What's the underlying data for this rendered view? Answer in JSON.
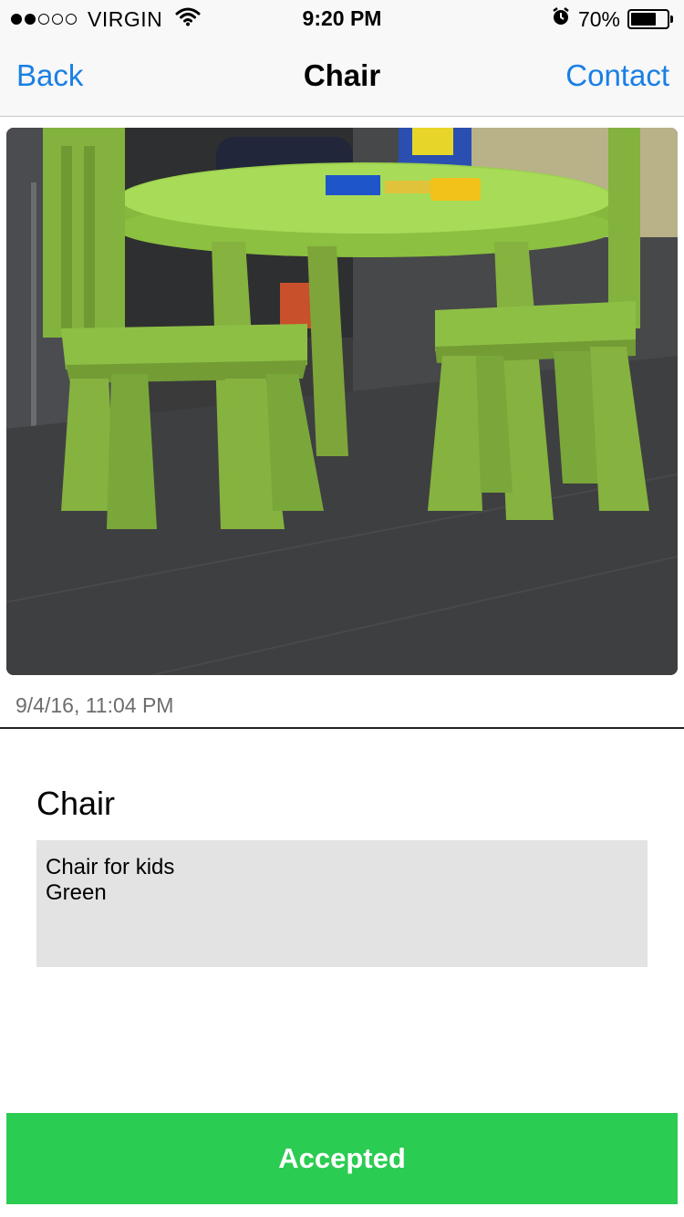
{
  "status_bar": {
    "carrier": "VIRGIN",
    "time": "9:20 PM",
    "battery": "70%",
    "battery_level": 0.7,
    "signal_bars_filled": 2,
    "signal_bars_total": 5
  },
  "nav": {
    "back_label": "Back",
    "title": "Chair",
    "contact_label": "Contact"
  },
  "listing": {
    "timestamp": "9/4/16, 11:04 PM",
    "title": "Chair",
    "description": "Chair for kids\nGreen"
  },
  "action": {
    "status_label": "Accepted",
    "color": "#2bcc52"
  },
  "colors": {
    "accent": "#1a7fe6"
  }
}
